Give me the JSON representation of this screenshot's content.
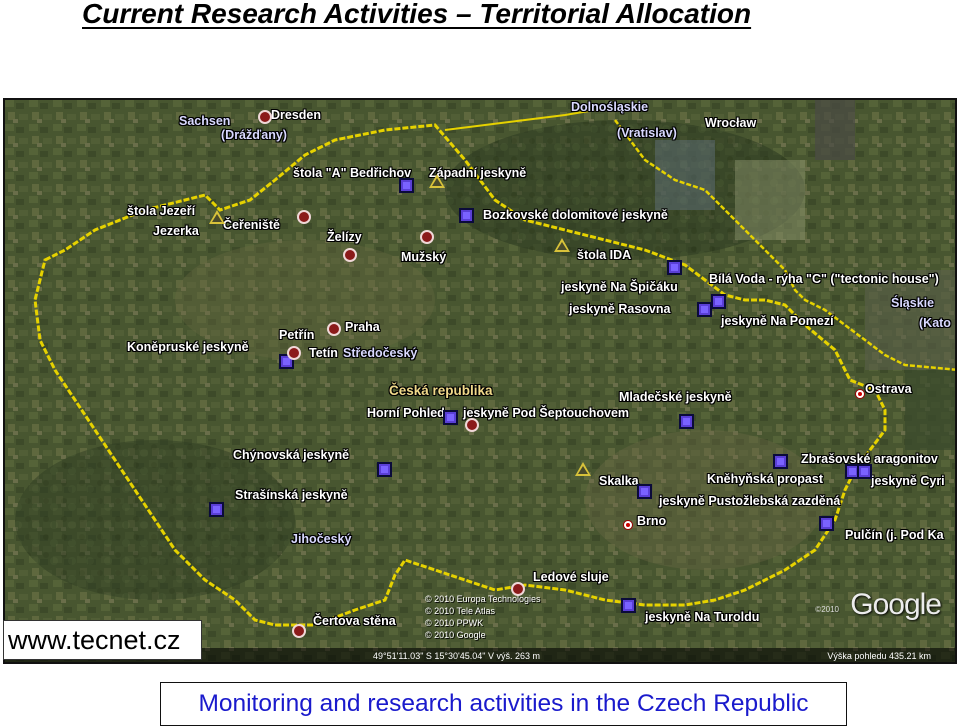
{
  "title": "Current Research Activities – Territorial Allocation",
  "website": "www.tecnet.cz",
  "caption": "Monitoring and research activities in the Czech Republic",
  "map": {
    "labels": {
      "sachsen": "Sachsen",
      "drazdany": "(Drážďany)",
      "dresden": "Dresden",
      "dolnoslaskie": "Dolnośląskie",
      "vratislav": "(Vratislav)",
      "wroclaw": "Wrocław",
      "stola_a": "štola \"A\" Bedřichov",
      "zapadni": "Západní jeskyně",
      "stola_jezeri": "štola Jezeří",
      "jezerka": "Jezerka",
      "cerenisti": "Čeřeniště",
      "bozkovske": "Bozkovské dolomitové jeskyně",
      "zelizy": "Želízy",
      "muzsky": "Mužský",
      "stola_ida": "štola IDA",
      "spicaku": "jeskyně Na Špičáku",
      "bila_voda": "Bílá Voda - rýha \"C\" (\"tectonic house\")",
      "rasovna": "jeskyně Rasovna",
      "slaskie": "Śląskie",
      "katowice": "(Kato",
      "pomezi": "jeskyně Na Pomezí",
      "petrin": "Petřín",
      "praha": "Praha",
      "konepruske": "Koněpruské jeskyně",
      "tetin": "Tetín",
      "stredocesky": "Středočeský",
      "ceska_republika": "Česká republika",
      "ostrava": "Ostrava",
      "mladecske": "Mladečské jeskyně",
      "horni_pohled": "Horní Pohled",
      "septouchovem": "jeskyně Pod Šeptouchovem",
      "chynovska": "Chýnovská jeskyně",
      "zbrasovske": "Zbrašovské aragonitov",
      "knehynska": "Kněhyňská propast",
      "cyril": "jeskyně Cyri",
      "skalka": "Skalka",
      "pustozlebska": "jeskyně Pustožlebská zazděná",
      "strasinska": "Strašínská jeskyně",
      "brno": "Brno",
      "pulcin": "Pulčín (j. Pod Ka",
      "jihocesky": "Jihočeský",
      "ledove": "Ledové sluje",
      "certova": "Čertova stěna",
      "turoldu": "jeskyně Na Turoldu"
    },
    "copyright": [
      "© 2010 Europa Technologies",
      "© 2010 Tele Atlas",
      "© 2010 PPWK",
      "© 2010 Google"
    ],
    "status_coords": "49°51'11.03\" S   15°30'45.04\" V  výš.  263 m",
    "status_eye": "Výška pohledu   435.21 km",
    "google_year": "©2010",
    "google_logo": "Google"
  },
  "colors": {
    "border": "#e6d200",
    "marker_square": "#5a3fd6",
    "marker_dot": "#8b1a1a",
    "marker_triangle": "#d8c23a",
    "caption_text": "#1a1acc"
  }
}
